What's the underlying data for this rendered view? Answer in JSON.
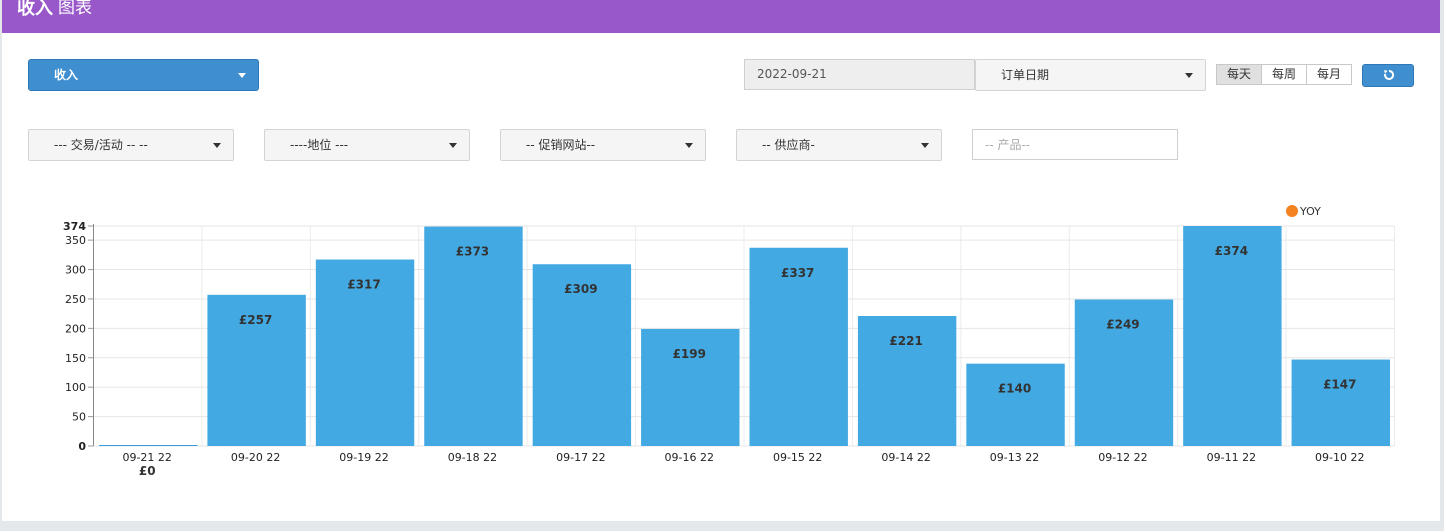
{
  "header": {
    "title_bold": "收入",
    "title_rest": "图表"
  },
  "controls": {
    "metric_select": "收入",
    "date_value": "2022-09-21",
    "date_type_select": "订单日期",
    "period_buttons": [
      "每天",
      "每周",
      "每月"
    ],
    "active_period": "每天",
    "refresh_icon": "refresh-icon"
  },
  "filters": {
    "campaign": "--- 交易/活动 -- --",
    "location": "----地位 ---",
    "promo_site": "-- 促销网站--",
    "supplier": "-- 供应商-",
    "product_placeholder": "-- 产品--"
  },
  "colors": {
    "header": "#9958c9",
    "bar": "#42a9e3",
    "legend_dot": "#f5821f",
    "button": "#3f8fd0"
  },
  "chart_data": {
    "type": "bar",
    "categories": [
      "09-21 22",
      "09-20 22",
      "09-19 22",
      "09-18 22",
      "09-17 22",
      "09-16 22",
      "09-15 22",
      "09-14 22",
      "09-13 22",
      "09-12 22",
      "09-11 22",
      "09-10 22"
    ],
    "values": [
      0,
      257,
      317,
      373,
      309,
      199,
      337,
      221,
      140,
      249,
      374,
      147
    ],
    "data_labels": [
      "£0",
      "£257",
      "£317",
      "£373",
      "£309",
      "£199",
      "£337",
      "£221",
      "£140",
      "£249",
      "£374",
      "£147"
    ],
    "legend": [
      "YOY"
    ],
    "legend_position": "top-right",
    "y_ticks": [
      "0",
      "50",
      "100",
      "150",
      "200",
      "250",
      "300",
      "350",
      "374"
    ],
    "y_tick_values": [
      0,
      50,
      100,
      150,
      200,
      250,
      300,
      350,
      374
    ],
    "ylim": [
      0,
      374
    ],
    "grid": true
  }
}
